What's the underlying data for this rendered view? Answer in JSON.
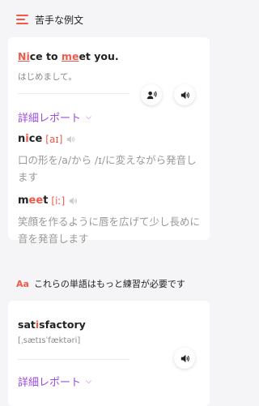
{
  "header": {
    "title": "苦手な例文",
    "icon": "list-icon"
  },
  "card1": {
    "sentence_part1": "Ni",
    "sentence_part2": "ce",
    "sentence_part3": " to ",
    "sentence_part4": "me",
    "sentence_part5": "et",
    "sentence_part6": " you.",
    "translation": "はじめまして。",
    "report_label": "詳細レポート",
    "words": [
      {
        "w1": "n",
        "w2": "i",
        "w3": "ce",
        "phonetic": "[aɪ]",
        "desc": "口の形を/a/から /ɪ/に変えながら発音します"
      },
      {
        "w1": "m",
        "w2": "ee",
        "w3": "t",
        "phonetic": "[iː]",
        "desc": "笑顔を作るように唇を広げて少し長めに音を発音します"
      }
    ]
  },
  "section": {
    "badge": "Aa",
    "title": "これらの単語はもっと練習が必要です"
  },
  "card2": {
    "w1": "sat",
    "w2": "i",
    "w3": "sfactory",
    "phonetic": "[ˌsætɪsˈfæktəri]",
    "report_label": "詳細レポート"
  },
  "colors": {
    "accent": "#ef5a4b",
    "purple": "#9b4be0"
  }
}
